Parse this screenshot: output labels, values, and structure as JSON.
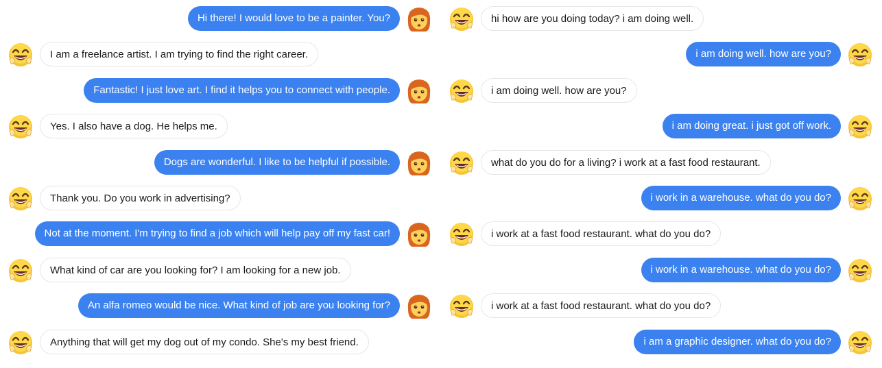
{
  "left_chat": [
    {
      "side": "out",
      "text": "Hi there! I would love to be a painter. You?",
      "avatar": "woman-face-icon"
    },
    {
      "side": "in",
      "text": "I am a freelance artist. I am trying to find the right career.",
      "avatar": "grinning-face-icon"
    },
    {
      "side": "out",
      "text": "Fantastic! I just love art. I find it helps you to connect with people.",
      "avatar": "woman-face-icon"
    },
    {
      "side": "in",
      "text": "Yes. I also have a dog. He helps me.",
      "avatar": "grinning-face-icon"
    },
    {
      "side": "out",
      "text": "Dogs are wonderful. I like to be helpful if possible.",
      "avatar": "woman-face-icon"
    },
    {
      "side": "in",
      "text": "Thank you. Do you work in advertising?",
      "avatar": "grinning-face-icon"
    },
    {
      "side": "out",
      "text": "Not at the moment. I'm trying to find a job which will help pay off my fast car!",
      "avatar": "woman-face-icon"
    },
    {
      "side": "in",
      "text": "What kind of car are you looking for? I am looking for a new job.",
      "avatar": "grinning-face-icon"
    },
    {
      "side": "out",
      "text": "An alfa romeo would be nice. What kind of job are you looking for?",
      "avatar": "woman-face-icon"
    },
    {
      "side": "in",
      "text": "Anything that will get my dog out of my condo. She's my best friend.",
      "avatar": "grinning-face-icon"
    }
  ],
  "right_chat": [
    {
      "side": "in",
      "text": "hi how are you doing today? i am doing well.",
      "avatar": "grinning-face-icon"
    },
    {
      "side": "out",
      "text": "i am doing well. how are you?",
      "avatar": "grinning-face-icon"
    },
    {
      "side": "in",
      "text": "i am doing well. how are you?",
      "avatar": "grinning-face-icon"
    },
    {
      "side": "out",
      "text": "i am doing great. i just got off work.",
      "avatar": "grinning-face-icon"
    },
    {
      "side": "in",
      "text": "what do you do for a living? i work at a fast food restaurant.",
      "avatar": "grinning-face-icon"
    },
    {
      "side": "out",
      "text": "i work in a warehouse. what do you do?",
      "avatar": "grinning-face-icon"
    },
    {
      "side": "in",
      "text": "i work at a fast food restaurant. what do you do?",
      "avatar": "grinning-face-icon"
    },
    {
      "side": "out",
      "text": "i work in a warehouse. what do you do?",
      "avatar": "grinning-face-icon"
    },
    {
      "side": "in",
      "text": "i work at a fast food restaurant. what do you do?",
      "avatar": "grinning-face-icon"
    },
    {
      "side": "out",
      "text": "i am a graphic designer. what do you do?",
      "avatar": "grinning-face-icon"
    }
  ],
  "colors": {
    "outgoing_bubble": "#3b82f0",
    "incoming_border": "#e6e6e6",
    "background": "#ffffff"
  }
}
